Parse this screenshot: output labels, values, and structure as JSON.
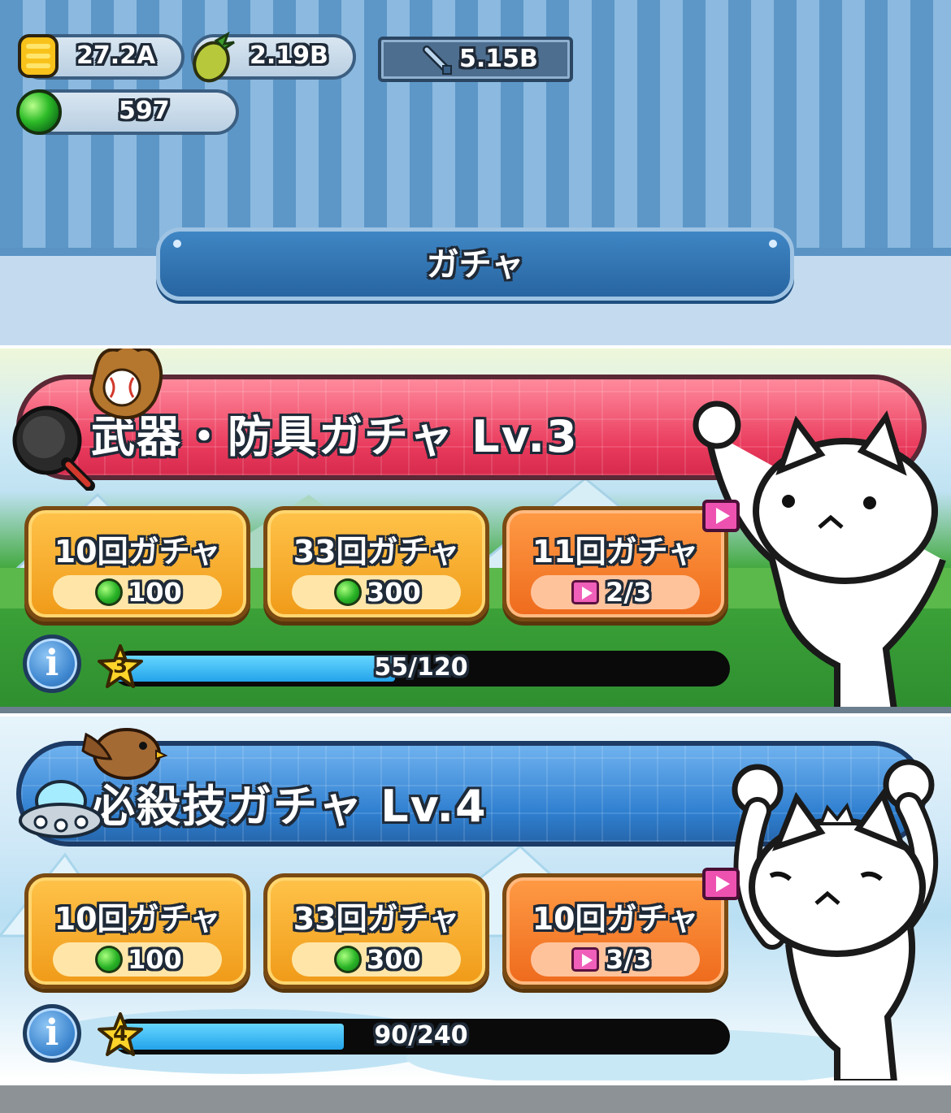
{
  "currencies": {
    "coins": "27.2A",
    "fruit": "2.19B",
    "attack_power": "5.15B",
    "gems": "597"
  },
  "screen_title": "ガチャ",
  "gachas": [
    {
      "title": "武器・防具ガチャ Lv.3",
      "theme_color": "#e93a5c",
      "buttons": [
        {
          "label": "10回ガチャ",
          "cost_icon": "gem-icon",
          "cost": "100"
        },
        {
          "label": "33回ガチャ",
          "cost_icon": "gem-icon",
          "cost": "300"
        },
        {
          "label": "11回ガチャ",
          "cost_icon": "video-icon",
          "cost": "2/3"
        }
      ],
      "level": "3",
      "progress_text": "55/120",
      "progress_fraction": 0.458
    },
    {
      "title": "必殺技ガチャ Lv.4",
      "theme_color": "#2f7fd0",
      "buttons": [
        {
          "label": "10回ガチャ",
          "cost_icon": "gem-icon",
          "cost": "100"
        },
        {
          "label": "33回ガチャ",
          "cost_icon": "gem-icon",
          "cost": "300"
        },
        {
          "label": "10回ガチャ",
          "cost_icon": "video-icon",
          "cost": "3/3"
        }
      ],
      "level": "4",
      "progress_text": "90/240",
      "progress_fraction": 0.375
    }
  ]
}
